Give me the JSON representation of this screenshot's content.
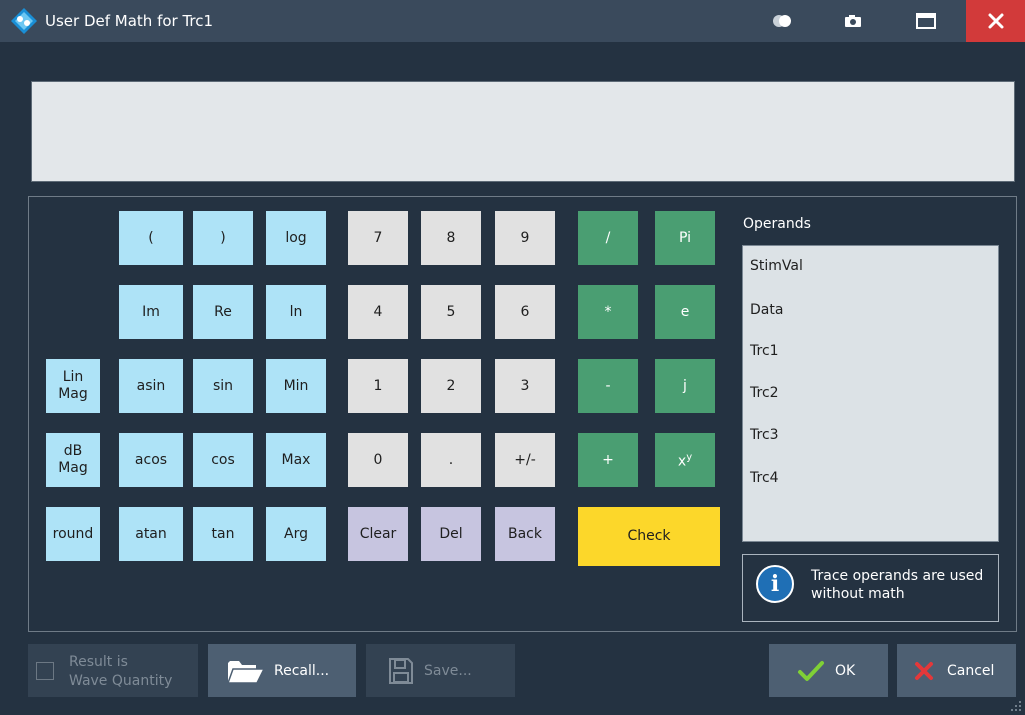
{
  "window": {
    "title": "User Def Math for Trc1",
    "accent": "#d23a3a"
  },
  "expression": {
    "value": ""
  },
  "keypad": {
    "open_paren": "(",
    "close_paren": ")",
    "log": "log",
    "im": "Im",
    "re": "Re",
    "ln": "ln",
    "lin_mag_1": "Lin",
    "lin_mag_2": "Mag",
    "asin": "asin",
    "sin": "sin",
    "min": "Min",
    "db_mag_1": "dB",
    "db_mag_2": "Mag",
    "acos": "acos",
    "cos": "cos",
    "max": "Max",
    "round": "round",
    "atan": "atan",
    "tan": "tan",
    "arg": "Arg",
    "d7": "7",
    "d8": "8",
    "d9": "9",
    "d4": "4",
    "d5": "5",
    "d6": "6",
    "d1": "1",
    "d2": "2",
    "d3": "3",
    "d0": "0",
    "dot": ".",
    "plus_minus": "+/-",
    "clear": "Clear",
    "del": "Del",
    "back": "Back",
    "divide": "/",
    "pi": "Pi",
    "multiply": "*",
    "e": "e",
    "minus": "-",
    "j": "j",
    "plus": "+",
    "power_base": "x",
    "power_exp": "y",
    "check": "Check"
  },
  "operands": {
    "label": "Operands",
    "items": [
      "StimVal",
      "Data",
      "Trc1",
      "Trc2",
      "Trc3",
      "Trc4"
    ]
  },
  "info": {
    "text": "Trace operands are used without math"
  },
  "footer": {
    "result_label_1": "Result is",
    "result_label_2": "Wave Quantity",
    "recall": "Recall...",
    "save": "Save...",
    "ok": "OK",
    "cancel": "Cancel"
  }
}
